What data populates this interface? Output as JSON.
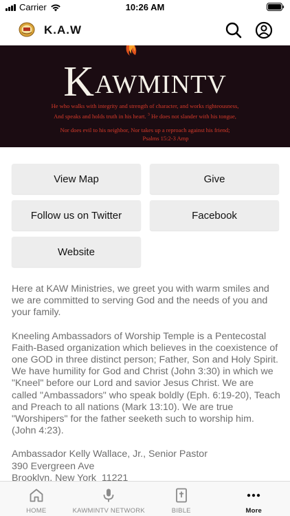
{
  "status_bar": {
    "carrier": "Carrier",
    "time": "10:26 AM"
  },
  "header": {
    "title": "K.A.W"
  },
  "banner": {
    "brand_first": "K",
    "brand_rest": "AWMINTV",
    "verse_line1": "He who walks with integrity and strength of character, and works righteousness,",
    "verse_line2": "And speaks and holds truth in his heart.",
    "verse_mark": "3",
    "verse_line2b": "He does not slander with his tongue,",
    "verse_line3": "Nor does evil to his neighbor, Nor takes up a reproach against his friend;",
    "verse_ref": "Psalms 15:2-3 Amp"
  },
  "actions": {
    "view_map": "View Map",
    "give": "Give",
    "twitter": "Follow us on Twitter",
    "facebook": "Facebook",
    "website": "Website"
  },
  "content": {
    "intro": "Here at KAW Ministries, we greet you with warm smiles and we are committed to serving God and the needs of you and your family.",
    "about": "Kneeling Ambassadors of Worship Temple is a Pentecostal Faith-Based organization which believes in the coexistence of one GOD in three distinct person; Father, Son and Holy Spirit. We have humility for God and Christ (John 3:30) in which we \"Kneel\" before our Lord and savior Jesus Christ. We are called \"Ambassadors\" who speak boldly (Eph. 6:19-20), Teach and Preach to all nations (Mark 13:10). We are true \"Worshipers\" for the father seeketh such to worship him. (John 4:23).",
    "pastor": "Ambassador Kelly Wallace, Jr., Senior Pastor",
    "street": "390 Evergreen Ave",
    "city": "Brooklyn, New York  11221"
  },
  "tabs": [
    {
      "label": "HOME",
      "icon": "home-icon"
    },
    {
      "label": "KAWMINTV NETWORK",
      "icon": "microphone-icon"
    },
    {
      "label": "BIBLE",
      "icon": "bible-icon"
    },
    {
      "label": "More",
      "icon": "more-icon"
    }
  ]
}
